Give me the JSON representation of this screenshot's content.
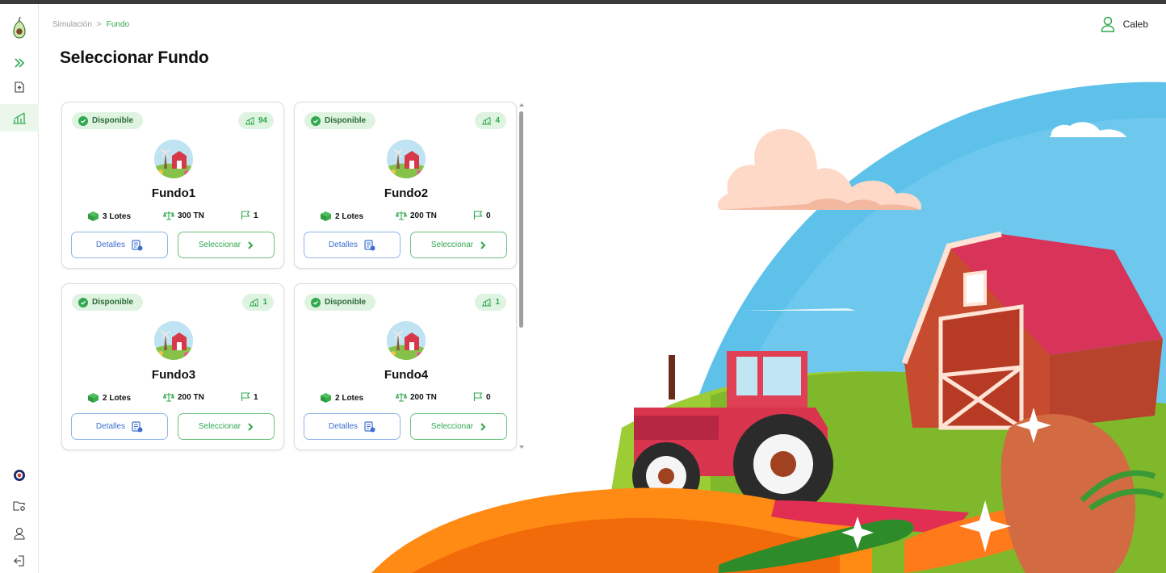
{
  "breadcrumb": {
    "parent": "Simulación",
    "separator": ">",
    "current": "Fundo"
  },
  "user": {
    "name": "Caleb"
  },
  "page": {
    "title": "Seleccionar Fundo"
  },
  "sidebar": {
    "top_items": [
      {
        "icon": "avocado-logo-icon"
      },
      {
        "icon": "expand-chevrons-icon"
      },
      {
        "icon": "file-upload-icon"
      },
      {
        "icon": "chart-icon",
        "active": true
      }
    ],
    "bottom_items": [
      {
        "icon": "emblem-icon"
      },
      {
        "icon": "folder-settings-icon"
      },
      {
        "icon": "user-icon"
      },
      {
        "icon": "logout-icon"
      }
    ]
  },
  "colors": {
    "accent": "#2fa84f",
    "badge_bg": "#dff3e1",
    "details_blue": "#3d6fd1"
  },
  "fundos": [
    {
      "status": "Disponible",
      "count": "94",
      "name": "Fundo1",
      "lotes": "3 Lotes",
      "tn": "300 TN",
      "flags": "1",
      "details_label": "Detalles",
      "select_label": "Seleccionar"
    },
    {
      "status": "Disponible",
      "count": "4",
      "name": "Fundo2",
      "lotes": "2 Lotes",
      "tn": "200 TN",
      "flags": "0",
      "details_label": "Detalles",
      "select_label": "Seleccionar"
    },
    {
      "status": "Disponible",
      "count": "1",
      "name": "Fundo3",
      "lotes": "2 Lotes",
      "tn": "200 TN",
      "flags": "1",
      "details_label": "Detalles",
      "select_label": "Seleccionar"
    },
    {
      "status": "Disponible",
      "count": "1",
      "name": "Fundo4",
      "lotes": "2 Lotes",
      "tn": "200 TN",
      "flags": "0",
      "details_label": "Detalles",
      "select_label": "Seleccionar"
    }
  ]
}
